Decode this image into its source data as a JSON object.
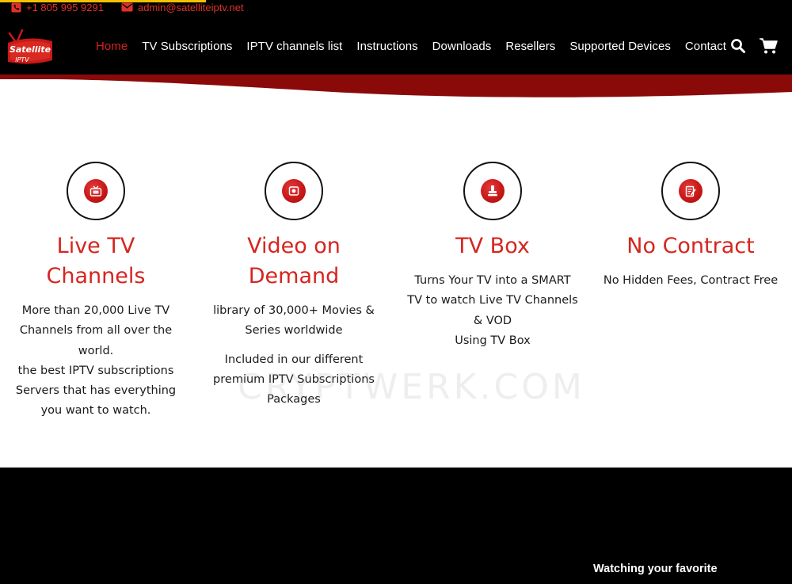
{
  "topbar": {
    "phone": "+1 805 995 9291",
    "email": "admin@satelliteiptv.net",
    "phone_icon": "phone-icon",
    "email_icon": "envelope-icon"
  },
  "logo": {
    "line1": "Satellite",
    "line2": "IPTV"
  },
  "nav": {
    "items": [
      {
        "label": "Home",
        "active": true
      },
      {
        "label": "TV Subscriptions"
      },
      {
        "label": "IPTV channels list"
      },
      {
        "label": "Instructions"
      },
      {
        "label": "Downloads"
      },
      {
        "label": "Resellers"
      },
      {
        "label": "Supported Devices"
      },
      {
        "label": "Contact us"
      }
    ],
    "search_icon": "search-icon",
    "cart_icon": "cart-icon"
  },
  "features": [
    {
      "title_lines": [
        "Live TV",
        "Channels"
      ],
      "icon": "live-tv-icon",
      "paragraphs": [
        [
          "More than 20,000 Live TV",
          "Channels from all over the",
          "world.",
          "the best IPTV subscriptions",
          "Servers that has everything",
          "you want to watch."
        ]
      ]
    },
    {
      "title_lines": [
        "Video on",
        "Demand"
      ],
      "icon": "video-icon",
      "paragraphs": [
        [
          "library of 30,000+ Movies &",
          "Series worldwide"
        ],
        [
          "Included in our different",
          "premium IPTV Subscriptions",
          "Packages"
        ]
      ]
    },
    {
      "title_lines": [
        "TV Box"
      ],
      "icon": "tv-box-icon",
      "paragraphs": [
        [
          "Turns Your TV into a SMART",
          "TV to watch Live TV Channels",
          "& VOD",
          "Using TV Box"
        ]
      ]
    },
    {
      "title_lines": [
        "No Contract"
      ],
      "icon": "contract-icon",
      "paragraphs": [
        [
          "No Hidden Fees, Contract Free"
        ]
      ]
    }
  ],
  "watermark": "CRYPTWERK.COM",
  "bottom": {
    "text": "Watching your favorite"
  },
  "colors": {
    "accent": "#d6251f",
    "header": "#000000",
    "curve": "#8a0a0a"
  }
}
